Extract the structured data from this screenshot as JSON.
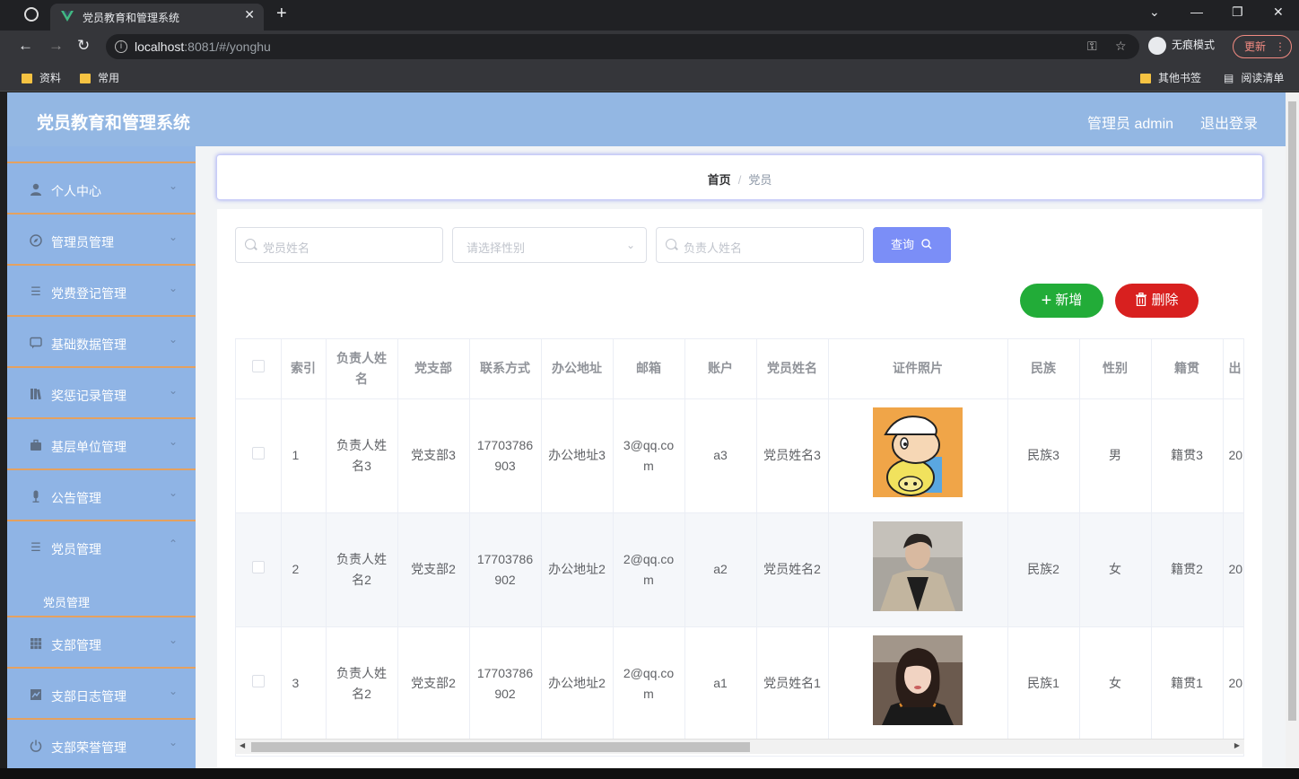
{
  "browser": {
    "tab_title": "党员教育和管理系统",
    "tab_close": "✕",
    "new_tab": "+",
    "url_host": "localhost",
    "url_rest": ":8081/#/yonghu",
    "incognito_label": "无痕模式",
    "update_label": "更新",
    "bookmarks": [
      "资料",
      "常用"
    ],
    "bookmarks_right": [
      "其他书签",
      "阅读清单"
    ]
  },
  "app": {
    "title": "党员教育和管理系统",
    "user_label": "管理员 admin",
    "logout_label": "退出登录"
  },
  "sidebar": {
    "items": [
      {
        "label": "个人中心",
        "icon": "user-icon"
      },
      {
        "label": "管理员管理",
        "icon": "compass-icon"
      },
      {
        "label": "党费登记管理",
        "icon": "list-icon"
      },
      {
        "label": "基础数据管理",
        "icon": "chat-icon"
      },
      {
        "label": "奖惩记录管理",
        "icon": "book-icon"
      },
      {
        "label": "基层单位管理",
        "icon": "briefcase-icon"
      },
      {
        "label": "公告管理",
        "icon": "mic-icon"
      },
      {
        "label": "党员管理",
        "icon": "list-icon"
      },
      {
        "label": "支部管理",
        "icon": "grid-icon"
      },
      {
        "label": "支部日志管理",
        "icon": "chart-icon"
      },
      {
        "label": "支部荣誉管理",
        "icon": "power-icon"
      }
    ],
    "submenu_label": "党员管理"
  },
  "breadcrumb": {
    "home": "首页",
    "separator": "/",
    "current": "党员"
  },
  "filters": {
    "name_placeholder": "党员姓名",
    "gender_placeholder": "请选择性别",
    "leader_placeholder": "负责人姓名",
    "query_label": "查询"
  },
  "actions": {
    "add_label": "新增",
    "delete_label": "删除"
  },
  "table": {
    "headers": [
      "索引",
      "负责人姓名",
      "党支部",
      "联系方式",
      "办公地址",
      "邮箱",
      "账户",
      "党员姓名",
      "证件照片",
      "民族",
      "性别",
      "籍贯",
      "出"
    ],
    "rows": [
      {
        "index": "1",
        "leader": "负责人姓名3",
        "branch": "党支部3",
        "phone": "17703786903",
        "address": "办公地址3",
        "email": "3@qq.com",
        "account": "a3",
        "name": "党员姓名3",
        "photo": "cartoon-photo",
        "ethnic": "民族3",
        "gender": "男",
        "origin": "籍贯3",
        "extra": "20"
      },
      {
        "index": "2",
        "leader": "负责人姓名2",
        "branch": "党支部2",
        "phone": "17703786902",
        "address": "办公地址2",
        "email": "2@qq.com",
        "account": "a2",
        "name": "党员姓名2",
        "photo": "man-photo",
        "ethnic": "民族2",
        "gender": "女",
        "origin": "籍贯2",
        "extra": "20"
      },
      {
        "index": "3",
        "leader": "负责人姓名2",
        "branch": "党支部2",
        "phone": "17703786902",
        "address": "办公地址2",
        "email": "2@qq.com",
        "account": "a1",
        "name": "党员姓名1",
        "photo": "woman-photo",
        "ethnic": "民族1",
        "gender": "女",
        "origin": "籍贯1",
        "extra": "20"
      }
    ]
  },
  "colors": {
    "header_bg": "#93b7e3",
    "sidebar_bg": "#8fb4e5",
    "menu_divider": "#e4a160",
    "query_btn": "#7b8ef7",
    "add_btn": "#22ac38",
    "delete_btn": "#d8201f"
  }
}
